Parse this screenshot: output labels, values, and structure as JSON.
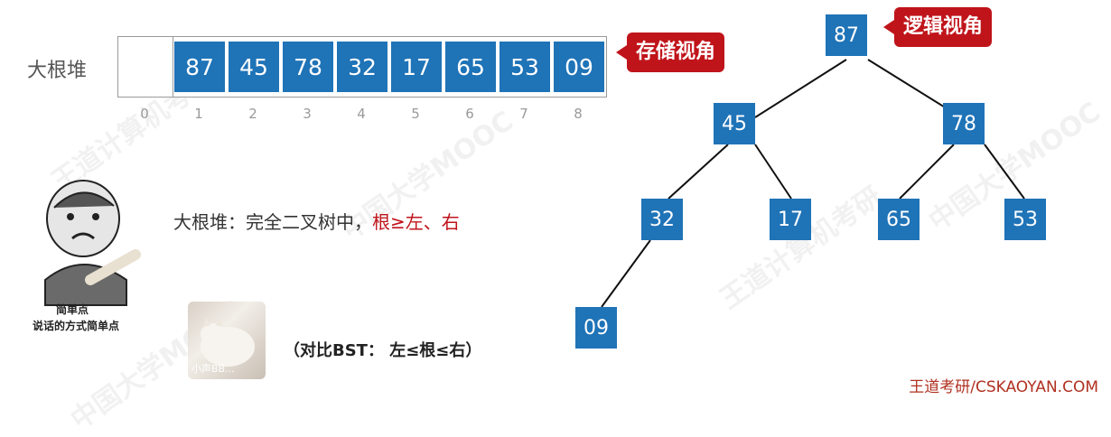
{
  "array": {
    "label": "大根堆",
    "values": [
      "87",
      "45",
      "78",
      "32",
      "17",
      "65",
      "53",
      "09"
    ],
    "indices": [
      "0",
      "1",
      "2",
      "3",
      "4",
      "5",
      "6",
      "7",
      "8"
    ]
  },
  "callouts": {
    "storage": "存储视角",
    "logical": "逻辑视角"
  },
  "definition": {
    "prefix": "大根堆：完全二叉树中，",
    "highlight": "根≥左、右"
  },
  "bst_note": "（对比BST： 左≤根≤右）",
  "meme": {
    "caption_line1": "简单点",
    "caption_line2": "说话的方式简单点"
  },
  "cat_caption": "小声BB...",
  "tree": {
    "nodes": [
      "87",
      "45",
      "78",
      "32",
      "17",
      "65",
      "53",
      "09"
    ]
  },
  "footer": "王道考研/CSKAOYAN.COM",
  "watermarks": [
    "王道计算机考研",
    "中国大学MOOC"
  ],
  "colors": {
    "node": "#1f73b7",
    "callout": "#c0141b",
    "highlight": "#c0141b"
  }
}
